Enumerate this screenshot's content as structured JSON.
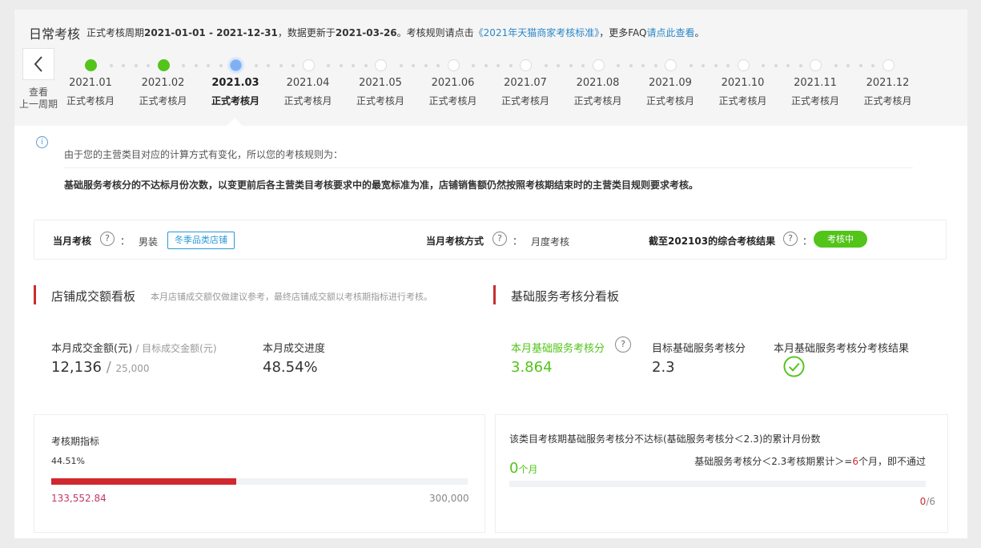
{
  "header": {
    "title": "日常考核",
    "cycle_prefix": "正式考核周期",
    "cycle": "2021-01-01 - 2021-12-31",
    "update_prefix": "，数据更新于",
    "update_date": "2021-03-26",
    "rule_prefix": "。考核规则请点击",
    "rule_link": "《2021年天猫商家考核标准》",
    "faq_prefix": "，更多FAQ",
    "faq_link": "请点此查看",
    "faq_suffix": "。"
  },
  "timeline": {
    "prev_label_1": "查看",
    "prev_label_2": "上一周期",
    "months": [
      {
        "month": "2021.01",
        "sub": "正式考核月",
        "status": "done"
      },
      {
        "month": "2021.02",
        "sub": "正式考核月",
        "status": "done"
      },
      {
        "month": "2021.03",
        "sub": "正式考核月",
        "status": "current"
      },
      {
        "month": "2021.04",
        "sub": "正式考核月",
        "status": "pending"
      },
      {
        "month": "2021.05",
        "sub": "正式考核月",
        "status": "pending"
      },
      {
        "month": "2021.06",
        "sub": "正式考核月",
        "status": "pending"
      },
      {
        "month": "2021.07",
        "sub": "正式考核月",
        "status": "pending"
      },
      {
        "month": "2021.08",
        "sub": "正式考核月",
        "status": "pending"
      },
      {
        "month": "2021.09",
        "sub": "正式考核月",
        "status": "pending"
      },
      {
        "month": "2021.10",
        "sub": "正式考核月",
        "status": "pending"
      },
      {
        "month": "2021.11",
        "sub": "正式考核月",
        "status": "pending"
      },
      {
        "month": "2021.12",
        "sub": "正式考核月",
        "status": "pending"
      }
    ]
  },
  "notice": {
    "line1": "由于您的主营类目对应的计算方式有变化，所以您的考核规则为：",
    "line2": "基础服务考核分的不达标月份次数，以变更前后各主营类目考核要求中的最宽标准为准，店铺销售额仍然按照考核期结束时的主营类目规则要求考核。"
  },
  "status": {
    "month_label": "当月考核",
    "month_value": "男装",
    "month_tag": "冬季品类店铺",
    "method_label": "当月考核方式",
    "method_value": "月度考核",
    "result_label": "截至202103的综合考核结果",
    "result_tag": "考核中",
    "colon": "："
  },
  "sales_board": {
    "title": "店铺成交额看板",
    "note": "本月店铺成交额仅做建议参考，最终店铺成交额以考核期指标进行考核。",
    "amount_label": "本月成交金额(元)",
    "target_label": "/ 目标成交金额(元)",
    "amount_value": "12,136",
    "target_value": "25,000",
    "slash": "/",
    "progress_label": "本月成交进度",
    "progress_value": "48.54%",
    "period_title": "考核期指标",
    "period_percent": "44.51%",
    "period_fraction": 0.4451,
    "period_current": "133,552.84",
    "period_target": "300,000"
  },
  "service_board": {
    "title": "基础服务考核分看板",
    "score_label": "本月基础服务考核分",
    "score_value": "3.864",
    "target_label": "目标基础服务考核分",
    "target_value": "2.3",
    "result_label": "本月基础服务考核分考核结果",
    "result_icon": "check-circle-icon",
    "fail_title": "该类目考核期基础服务考核分不达标(基础服务考核分＜2.3)的累计月份数",
    "fail_count": "0",
    "fail_unit": "个月",
    "rule_prefix": "基础服务考核分＜2.3考核期累计＞=",
    "rule_num": "6",
    "rule_suffix": "个月，即不通过",
    "frac_num": "0",
    "frac_den": "/6",
    "fail_fraction": 0
  },
  "colors": {
    "green": "#52c41a",
    "red": "#d0282e",
    "link": "#2b87c9"
  }
}
